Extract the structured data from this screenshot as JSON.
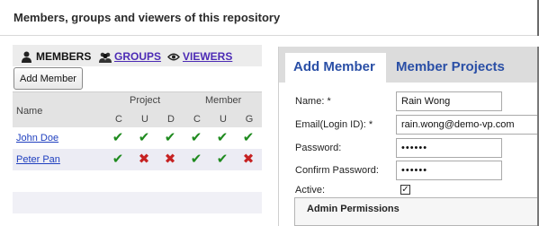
{
  "page": {
    "title": "Members, groups and viewers of this repository"
  },
  "left_tabs": [
    {
      "label": "MEMBERS",
      "icon": "user-icon"
    },
    {
      "label": "GROUPS",
      "icon": "group-icon"
    },
    {
      "label": "VIEWERS",
      "icon": "eye-icon"
    }
  ],
  "add_member_button": "Add Member",
  "grid": {
    "name_header": "Name",
    "group_headers": [
      "Project",
      "Member"
    ],
    "sub_headers": [
      "C",
      "U",
      "D",
      "C",
      "U",
      "G"
    ],
    "rows": [
      {
        "name": "John Doe",
        "perms": [
          true,
          true,
          true,
          true,
          true,
          true
        ]
      },
      {
        "name": "Peter Pan",
        "perms": [
          true,
          false,
          false,
          true,
          true,
          false
        ]
      }
    ]
  },
  "right_tabs": [
    "Add Member",
    "Member Projects"
  ],
  "form": {
    "name_label": "Name: *",
    "name_value": "Rain Wong",
    "email_label": "Email(Login ID): *",
    "email_value": "rain.wong@demo-vp.com",
    "password_label": "Password:",
    "password_value": "••••••",
    "confirm_label": "Confirm Password:",
    "confirm_value": "••••••",
    "active_label": "Active:",
    "active_checked": true,
    "admin_permissions_title": "Admin Permissions"
  },
  "colors": {
    "check_green": "#1e8a1e",
    "cross_red": "#c62222",
    "tab_blue": "#2a4fa6",
    "link_purple": "#4c2bb5"
  }
}
